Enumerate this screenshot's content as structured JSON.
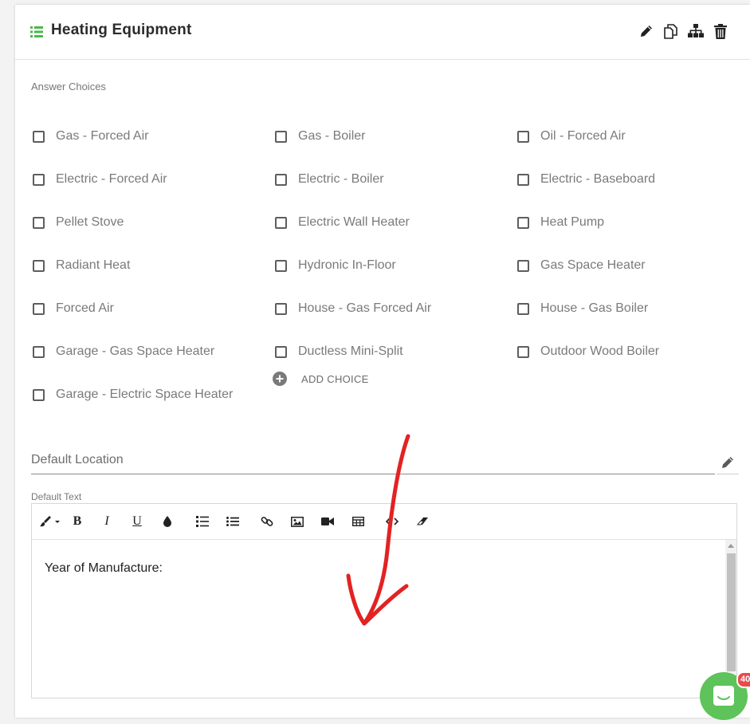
{
  "header": {
    "title": "Heating Equipment",
    "icons": {
      "list": "list-icon",
      "edit": "pencil-icon",
      "copy": "copy-icon",
      "hierarchy": "sitemap-icon",
      "delete": "trash-icon"
    }
  },
  "answer_choices": {
    "label": "Answer Choices",
    "items": [
      "Gas - Forced Air",
      "Electric - Forced Air",
      "Pellet Stove",
      "Radiant Heat",
      "Forced Air",
      "Garage - Gas Space Heater",
      "Garage - Electric Space Heater",
      "Gas - Boiler",
      "Electric - Boiler",
      "Electric Wall Heater",
      "Hydronic In-Floor",
      "House - Gas Forced Air",
      "Ductless Mini-Split",
      "Oil - Forced Air",
      "Electric - Baseboard",
      "Heat Pump",
      "Gas Space Heater",
      "House - Gas Boiler",
      "Outdoor Wood Boiler"
    ],
    "add_choice_label": "ADD CHOICE"
  },
  "default_location": {
    "placeholder": "Default Location",
    "value": ""
  },
  "default_text": {
    "label": "Default Text",
    "body": "Year of Manufacture:",
    "toolbar": {
      "bold": "B",
      "italic": "I",
      "underline": "U"
    }
  },
  "chat": {
    "badge": "40"
  },
  "colors": {
    "accent_green": "#5dc35a",
    "badge_red": "#e94b4b",
    "annotation_red": "#e32222"
  }
}
